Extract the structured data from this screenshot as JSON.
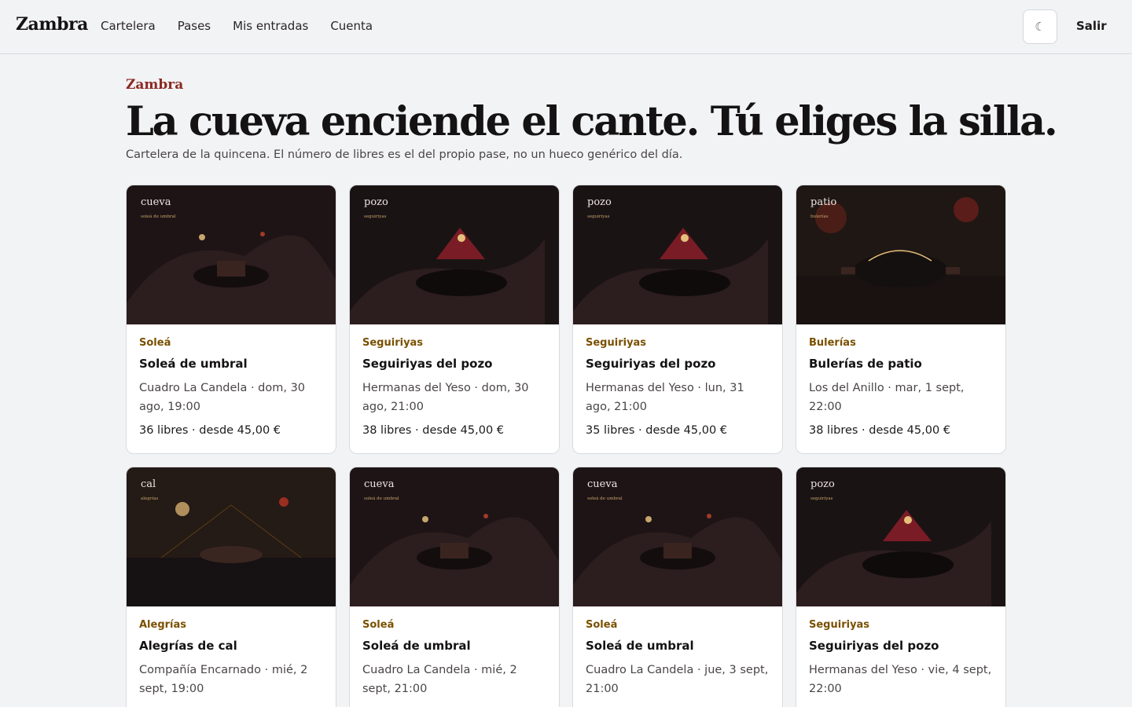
{
  "nav": {
    "brand": "Zambra",
    "links": [
      "Cartelera",
      "Pases",
      "Mis entradas",
      "Cuenta"
    ],
    "theme_icon": "☾",
    "logout": "Salir"
  },
  "hero": {
    "eyebrow": "Zambra",
    "headline": "La cueva enciende el cante. Tú eliges la silla.",
    "lede": "Cartelera de la quincena. El número de libres es el del propio pase, no un hueco genérico del día."
  },
  "shows": [
    {
      "art": "cueva",
      "art_label": "cueva",
      "art_sub": "soleá de umbral",
      "genre": "Soleá",
      "title": "Soleá de umbral",
      "meta": "Cuadro La Candela · dom, 30 ago, 19:00",
      "avail": "36 libres · desde 45,00 €"
    },
    {
      "art": "pozo",
      "art_label": "pozo",
      "art_sub": "seguiriyas",
      "genre": "Seguiriyas",
      "title": "Seguiriyas del pozo",
      "meta": "Hermanas del Yeso · dom, 30 ago, 21:00",
      "avail": "38 libres · desde 45,00 €"
    },
    {
      "art": "pozo",
      "art_label": "pozo",
      "art_sub": "seguiriyas",
      "genre": "Seguiriyas",
      "title": "Seguiriyas del pozo",
      "meta": "Hermanas del Yeso · lun, 31 ago, 21:00",
      "avail": "35 libres · desde 45,00 €"
    },
    {
      "art": "patio",
      "art_label": "patio",
      "art_sub": "bulerías",
      "genre": "Bulerías",
      "title": "Bulerías de patio",
      "meta": "Los del Anillo · mar, 1 sept, 22:00",
      "avail": "38 libres · desde 45,00 €"
    },
    {
      "art": "cal",
      "art_label": "cal",
      "art_sub": "alegrías",
      "genre": "Alegrías",
      "title": "Alegrías de cal",
      "meta": "Compañía Encarnado · mié, 2 sept, 19:00",
      "avail": ""
    },
    {
      "art": "cueva",
      "art_label": "cueva",
      "art_sub": "soleá de umbral",
      "genre": "Soleá",
      "title": "Soleá de umbral",
      "meta": "Cuadro La Candela · mié, 2 sept, 21:00",
      "avail": ""
    },
    {
      "art": "cueva",
      "art_label": "cueva",
      "art_sub": "soleá de umbral",
      "genre": "Soleá",
      "title": "Soleá de umbral",
      "meta": "Cuadro La Candela · jue, 3 sept, 21:00",
      "avail": ""
    },
    {
      "art": "pozo",
      "art_label": "pozo",
      "art_sub": "seguiriyas",
      "genre": "Seguiriyas",
      "title": "Seguiriyas del pozo",
      "meta": "Hermanas del Yeso · vie, 4 sept, 22:00",
      "avail": ""
    }
  ],
  "colors": {
    "accent": "#8c2a22",
    "genre": "#7a5000",
    "art_dark": "#1e1416",
    "art_mound": "#2c1d1e",
    "art_warm": "#e5c07b",
    "art_red": "#7a1c26"
  }
}
